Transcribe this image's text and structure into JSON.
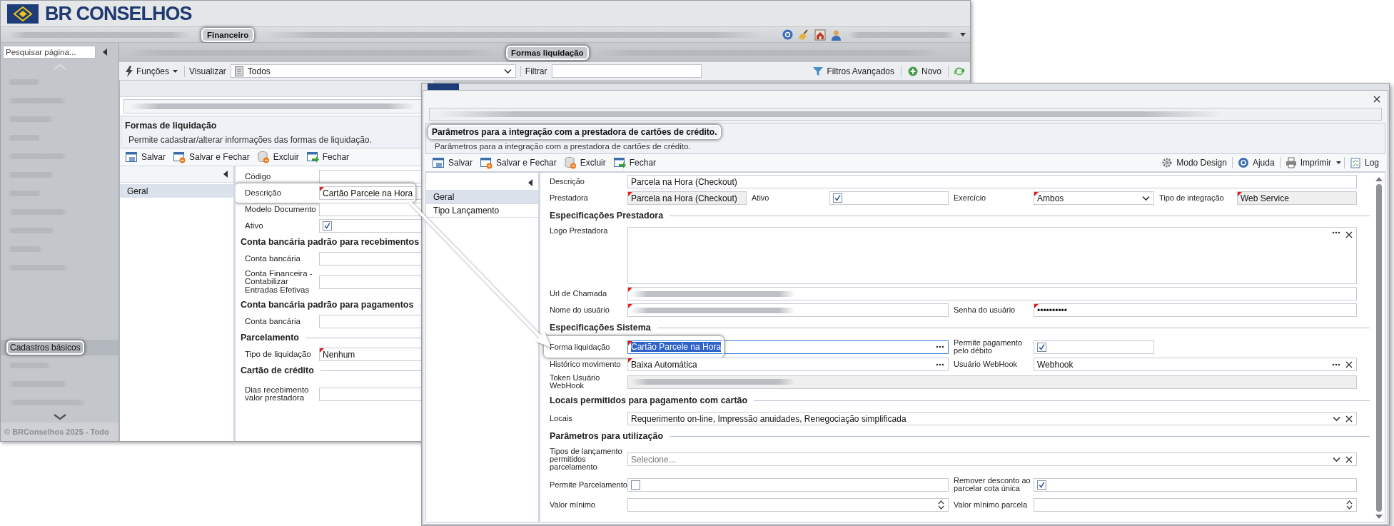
{
  "app": {
    "logo": "BR CONSELHOS",
    "menu": {
      "item": "Financeiro",
      "highlighted": true
    },
    "sidebar": {
      "search_placeholder": "Pesquisar página...",
      "item": {
        "label": "Cadastros básicos",
        "highlighted": true
      },
      "footer": "© BRConselhos 2025 - Todo"
    },
    "tab": {
      "label": "Formas liquidação",
      "highlighted": true
    },
    "toolbar": {
      "functions": "Funções",
      "view_label": "Visualizar",
      "view_value": "Todos",
      "filter_label": "Filtrar",
      "advanced_filters": "Filtros Avançados",
      "new": "Novo"
    },
    "page": {
      "title": "Formas de liquidação",
      "subtitle": "Permite cadastrar/alterar informações das formas de liquidação.",
      "actions": [
        "Salvar",
        "Salvar e Fechar",
        "Excluir",
        "Fechar"
      ],
      "nav": [
        {
          "label": "Geral",
          "selected": true
        }
      ],
      "form": [
        {
          "kind": "text",
          "label": "Código"
        },
        {
          "kind": "text",
          "label": "Descrição",
          "value": "Cartão Parcele na Hora",
          "required": true,
          "highlighted": true
        },
        {
          "kind": "text",
          "label": "Modelo Documento"
        },
        {
          "kind": "checkbox",
          "label": "Ativo",
          "checked": true
        },
        {
          "kind": "section",
          "title": "Conta bancária padrão para recebimentos"
        },
        {
          "kind": "text",
          "label": "Conta bancária"
        },
        {
          "kind": "text",
          "label": "Conta Financeira - Contabilizar Entradas Efetivas"
        },
        {
          "kind": "section",
          "title": "Conta bancária padrão para pagamentos"
        },
        {
          "kind": "text",
          "label": "Conta bancária"
        },
        {
          "kind": "section",
          "title": "Parcelamento"
        },
        {
          "kind": "text",
          "label": "Tipo de liquidação",
          "value": "Nenhum",
          "required": true
        },
        {
          "kind": "section",
          "title": "Cartão de crédito"
        },
        {
          "kind": "text",
          "label": "Dias recebimento valor prestadora"
        }
      ]
    }
  },
  "dialog": {
    "title": {
      "text": "Parâmetros para a integração com a prestadora de cartões de crédito.",
      "highlighted": true
    },
    "subtitle": "Parâmetros para a integração com a prestadora de cartões de crédito.",
    "actions": [
      "Salvar",
      "Salvar e Fechar",
      "Excluir",
      "Fechar"
    ],
    "tools": [
      "Modo Design",
      "Ajuda",
      "Imprimir",
      "Log"
    ],
    "nav": [
      {
        "label": "Geral",
        "selected": true
      },
      {
        "label": "Tipo Lançamento",
        "selected": false
      }
    ],
    "rows": [
      {
        "kind": "fields",
        "fields": [
          {
            "label": "Descrição",
            "kind": "text",
            "value": "Parcela na Hora (Checkout)"
          }
        ]
      },
      {
        "kind": "fields",
        "fields": [
          {
            "label": "Prestadora",
            "kind": "text",
            "value": "Parcela na Hora (Checkout)",
            "required": true,
            "disabled": true
          },
          {
            "label": "Ativo",
            "kind": "checkbox",
            "checked": true
          },
          {
            "label": "Exercício",
            "kind": "select",
            "value": "Ambos",
            "required": true,
            "clearable": false
          },
          {
            "label": "Tipo de integração",
            "kind": "text",
            "value": "Web Service",
            "required": true,
            "disabled": true
          }
        ]
      },
      {
        "kind": "section",
        "title": "Especificações Prestadora"
      },
      {
        "kind": "fields",
        "fields": [
          {
            "label": "Logo Prestadora",
            "kind": "image",
            "clearable": true
          }
        ]
      },
      {
        "kind": "fields",
        "fields": [
          {
            "label": "Url de Chamada",
            "kind": "text",
            "redacted": true,
            "required": true
          }
        ]
      },
      {
        "kind": "fields",
        "fields": [
          {
            "label": "Nome do usuário",
            "kind": "text",
            "redacted": true,
            "required": true
          },
          {
            "label": "Senha do usuário",
            "kind": "text",
            "value": "••••••••••",
            "required": true
          }
        ]
      },
      {
        "kind": "section",
        "title": "Especificações Sistema"
      },
      {
        "kind": "fields",
        "fields": [
          {
            "label": "Forma liquidação",
            "kind": "lookup",
            "value": "Cartão Parcele na Hora",
            "required": true,
            "focused": true,
            "text_selected": true,
            "highlighted": true,
            "clearable": false
          },
          {
            "label": "Permite pagamento pelo débito",
            "kind": "checkbox",
            "checked": true
          }
        ]
      },
      {
        "kind": "fields",
        "fields": [
          {
            "label": "Histórico movimento",
            "kind": "lookup",
            "value": "Baixa Automática",
            "required": true,
            "clearable": false
          },
          {
            "label": "Usuário WebHook",
            "kind": "lookup",
            "value": "Webhook",
            "clearable": true
          }
        ]
      },
      {
        "kind": "fields",
        "fields": [
          {
            "label": "Token Usuário WebHook",
            "kind": "text",
            "redacted": true,
            "disabled": true
          }
        ]
      },
      {
        "kind": "section",
        "title": "Locais permitidos para pagamento com cartão"
      },
      {
        "kind": "fields",
        "fields": [
          {
            "label": "Locais",
            "kind": "select",
            "value": "Requerimento on-line, Impressão anuidades, Renegociação simplificada",
            "clearable": true
          }
        ]
      },
      {
        "kind": "section",
        "title": "Parâmetros para utilização"
      },
      {
        "kind": "fields",
        "fields": [
          {
            "label": "Tipos de lançamento permitidos parcelamento",
            "kind": "select",
            "placeholder": "Selecione...",
            "clearable": true
          }
        ]
      },
      {
        "kind": "fields",
        "fields": [
          {
            "label": "Permite Parcelamento",
            "kind": "checkbox",
            "checked": false
          },
          {
            "label": "Remover desconto ao parcelar cota única",
            "kind": "checkbox",
            "checked": true
          }
        ]
      },
      {
        "kind": "fields",
        "fields": [
          {
            "label": "Valor mínimo",
            "kind": "spinner"
          },
          {
            "label": "Valor mínimo parcela",
            "kind": "spinner"
          }
        ]
      }
    ]
  }
}
